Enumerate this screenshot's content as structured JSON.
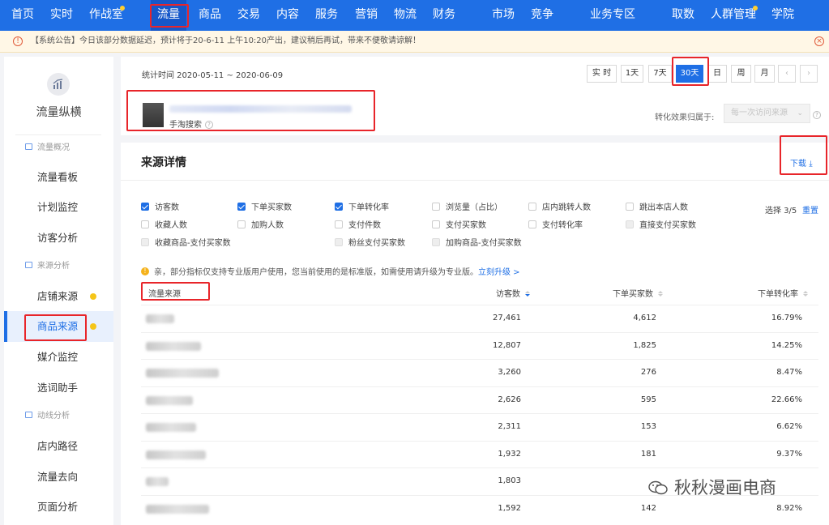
{
  "topnav": {
    "items": [
      "首页",
      "实时",
      "作战室",
      "流量",
      "商品",
      "交易",
      "内容",
      "服务",
      "营销",
      "物流",
      "财务",
      "市场",
      "竞争",
      "业务专区",
      "取数",
      "人群管理",
      "学院"
    ],
    "active": "流量"
  },
  "notice": {
    "text": "【系统公告】今日该部分数据延迟，预计将于20-6-11 上午10:20产出，建议稍后再试，带来不便敬请谅解！"
  },
  "sidebar": {
    "title": "流量纵横",
    "groups": [
      "流量概况",
      "来源分析",
      "动线分析"
    ],
    "items": [
      "流量看板",
      "计划监控",
      "访客分析",
      "店铺来源",
      "商品来源",
      "媒介监控",
      "选词助手",
      "店内路径",
      "流量去向",
      "页面分析"
    ],
    "active": "商品来源"
  },
  "header": {
    "stat_time": "统计时间 2020-05-11 ~ 2020-06-09",
    "time_buttons": [
      "实 时",
      "1天",
      "7天",
      "30天",
      "日",
      "周",
      "月",
      "‹",
      "›"
    ],
    "active_time": "30天",
    "item_subtitle": "手淘搜索",
    "attribution_label": "转化效果归属于:",
    "attribution_value": "每一次访问来源"
  },
  "detail": {
    "title": "来源详情",
    "download_label": "下载",
    "metrics": [
      {
        "label": "访客数",
        "checked": true,
        "disabled": false
      },
      {
        "label": "下单买家数",
        "checked": true,
        "disabled": false
      },
      {
        "label": "下单转化率",
        "checked": true,
        "disabled": false
      },
      {
        "label": "浏览量（占比）",
        "checked": false,
        "disabled": false
      },
      {
        "label": "店内跳转人数",
        "checked": false,
        "disabled": false
      },
      {
        "label": "跳出本店人数",
        "checked": false,
        "disabled": false
      },
      {
        "label": "收藏人数",
        "checked": false,
        "disabled": false
      },
      {
        "label": "加购人数",
        "checked": false,
        "disabled": false
      },
      {
        "label": "支付件数",
        "checked": false,
        "disabled": false
      },
      {
        "label": "支付买家数",
        "checked": false,
        "disabled": false
      },
      {
        "label": "支付转化率",
        "checked": false,
        "disabled": false
      },
      {
        "label": "直接支付买家数",
        "checked": false,
        "disabled": true
      },
      {
        "label": "收藏商品-支付买家数",
        "checked": false,
        "disabled": true
      },
      {
        "label": "粉丝支付买家数",
        "checked": false,
        "disabled": true
      },
      {
        "label": "加购商品-支付买家数",
        "checked": false,
        "disabled": true
      }
    ],
    "select_count": "选择 3/5",
    "reset_label": "重置",
    "tip_text": "亲，部分指标仅支持专业版用户使用，您当前使用的是标准版，如需使用请升级为专业版。",
    "tip_link": "立刻升级 >",
    "columns": [
      "流量来源",
      "访客数",
      "下单买家数",
      "下单转化率"
    ],
    "rows": [
      [
        "27,461",
        "4,612",
        "16.79%"
      ],
      [
        "12,807",
        "1,825",
        "14.25%"
      ],
      [
        "3,260",
        "276",
        "8.47%"
      ],
      [
        "2,626",
        "595",
        "22.66%"
      ],
      [
        "2,311",
        "153",
        "6.62%"
      ],
      [
        "1,932",
        "181",
        "9.37%"
      ],
      [
        "1,803",
        "",
        ""
      ],
      [
        "1,592",
        "142",
        "8.92%"
      ]
    ]
  },
  "watermark": "秋秋漫画电商"
}
